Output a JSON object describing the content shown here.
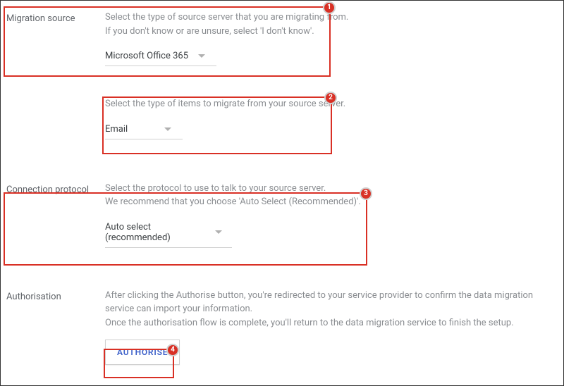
{
  "sections": {
    "source": {
      "label": "Migration source",
      "help1": "Select the type of source server that you are migrating from.",
      "help2": "If you don't know or are unsure, select 'I don't know'.",
      "dropdown": "Microsoft Office 365"
    },
    "items": {
      "help": "Select the type of items to migrate from your source server.",
      "dropdown": "Email"
    },
    "protocol": {
      "label": "Connection protocol",
      "help1": "Select the protocol to use to talk to your source server.",
      "help2": "We recommend that you choose 'Auto Select (Recommended)'.",
      "dropdown": "Auto select (recommended)"
    },
    "auth": {
      "label": "Authorisation",
      "help1": "After clicking the Authorise button, you're redirected to your service provider to confirm the data migration service can import your information.",
      "help2": "Once the authorisation flow is complete, you'll return to the data migration service to finish the setup.",
      "button": "AUTHORISE"
    }
  },
  "callouts": {
    "c1": "1",
    "c2": "2",
    "c3": "3",
    "c4": "4"
  }
}
